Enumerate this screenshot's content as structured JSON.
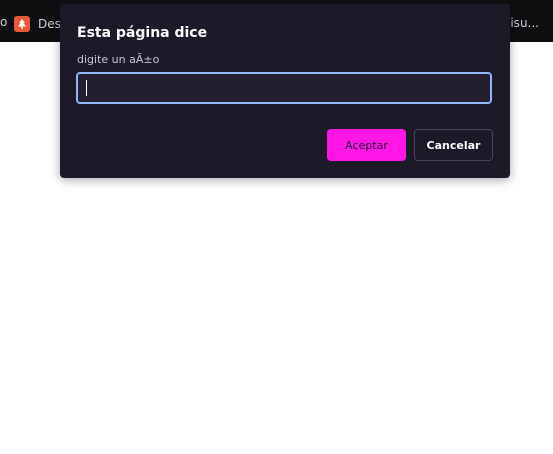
{
  "bookmarks_bar": {
    "left_edge_glyph": "o",
    "item_label": "Des",
    "right_item_label": "Visu..."
  },
  "dialog": {
    "title": "Esta página dice",
    "message": "digite un aÃ±o",
    "input_value": "",
    "ok_label": "Aceptar",
    "cancel_label": "Cancelar"
  },
  "colors": {
    "dialog_bg": "#1c1a29",
    "accent": "#ff16e6",
    "focus_ring": "#8fb6ff"
  }
}
